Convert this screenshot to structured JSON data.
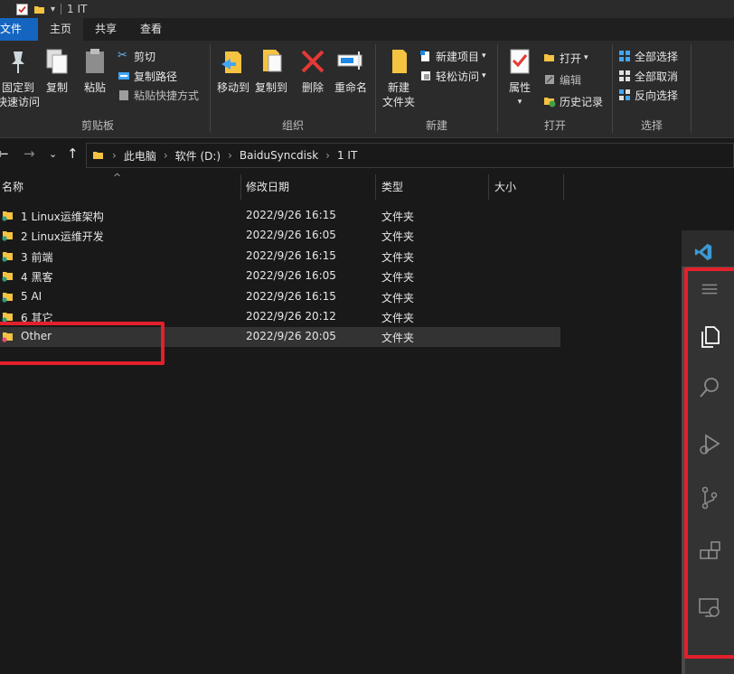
{
  "window": {
    "title": "1 IT"
  },
  "tabs": [
    {
      "label": "文件"
    },
    {
      "label": "主页"
    },
    {
      "label": "共享"
    },
    {
      "label": "查看"
    }
  ],
  "ribbon": {
    "clipboard": {
      "label": "剪贴板",
      "pin_label_1": "固定到",
      "pin_label_2": "快速访问",
      "copy_label": "复制",
      "paste_label": "粘贴",
      "cut_label": "剪切",
      "copy_path_label": "复制路径",
      "paste_shortcut_label": "粘贴快捷方式"
    },
    "organize": {
      "label": "组织",
      "move_to_label": "移动到",
      "copy_to_label": "复制到",
      "delete_label": "删除",
      "rename_label": "重命名"
    },
    "new": {
      "label": "新建",
      "new_folder_label_1": "新建",
      "new_folder_label_2": "文件夹",
      "new_item_label": "新建项目",
      "easy_access_label": "轻松访问"
    },
    "open": {
      "label": "打开",
      "properties_label": "属性",
      "open_label": "打开",
      "edit_label": "编辑",
      "history_label": "历史记录"
    },
    "select": {
      "label": "选择",
      "select_all_label": "全部选择",
      "select_none_label": "全部取消",
      "invert_label": "反向选择"
    }
  },
  "address": {
    "crumbs": [
      "此电脑",
      "软件 (D:)",
      "BaiduSyncdisk",
      "1 IT"
    ]
  },
  "columns": {
    "name": "名称",
    "modified": "修改日期",
    "type": "类型",
    "size": "大小"
  },
  "files": [
    {
      "name": "1 Linux运维架构",
      "modified": "2022/9/26 16:15",
      "type": "文件夹"
    },
    {
      "name": "2 Linux运维开发",
      "modified": "2022/9/26 16:05",
      "type": "文件夹"
    },
    {
      "name": "3 前端",
      "modified": "2022/9/26 16:15",
      "type": "文件夹"
    },
    {
      "name": "4 黑客",
      "modified": "2022/9/26 16:05",
      "type": "文件夹"
    },
    {
      "name": "5 AI",
      "modified": "2022/9/26 16:15",
      "type": "文件夹"
    },
    {
      "name": "6 其它",
      "modified": "2022/9/26 20:12",
      "type": "文件夹"
    },
    {
      "name": "Other",
      "modified": "2022/9/26 20:05",
      "type": "文件夹"
    }
  ],
  "colors": {
    "accent": "#1565c0",
    "highlight_box": "#e3202b",
    "folder": "#f5c342",
    "vscode_blue": "#3c99d4"
  },
  "vscode": {
    "activity_icons": [
      "menu-icon",
      "explorer-icon",
      "search-icon",
      "run-debug-icon",
      "source-control-icon",
      "extensions-icon",
      "remote-explorer-icon"
    ]
  }
}
